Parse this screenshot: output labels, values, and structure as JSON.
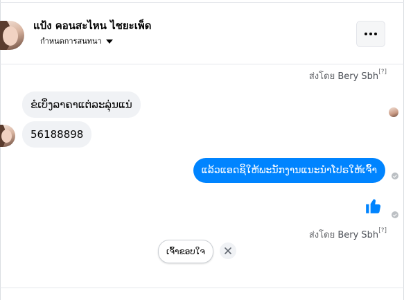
{
  "header": {
    "contact_name": "แป้ง คอนสะไหน ไชยะเพ็ด",
    "subtitle": "กำหนดการสนทนา"
  },
  "sent_by": {
    "prefix": "ส่งโดย",
    "name": "Bery Sbh",
    "marker": "[?]"
  },
  "messages": {
    "incoming": [
      "ຂໍເບິ່ງລາຄາແຕ່ລະລຸ່ນແນ່",
      "56188898"
    ],
    "outgoing": "ແລ້ວແອດຊິໃຫ້ພະນັກງານແນະນໍາໂປຣໃຫ້ເຈົ້າ"
  },
  "quick_reply": {
    "label": "ເຈົ້າຂອບໃຈ"
  },
  "colors": {
    "outgoing_bubble": "#0084ff",
    "incoming_bubble": "#f0f2f5",
    "like": "#0084ff"
  },
  "icons": {
    "menu": "more-dots-icon",
    "caret": "caret-down-icon",
    "like": "thumbs-up-icon",
    "dismiss": "close-icon",
    "status": "sent-check-icon"
  }
}
